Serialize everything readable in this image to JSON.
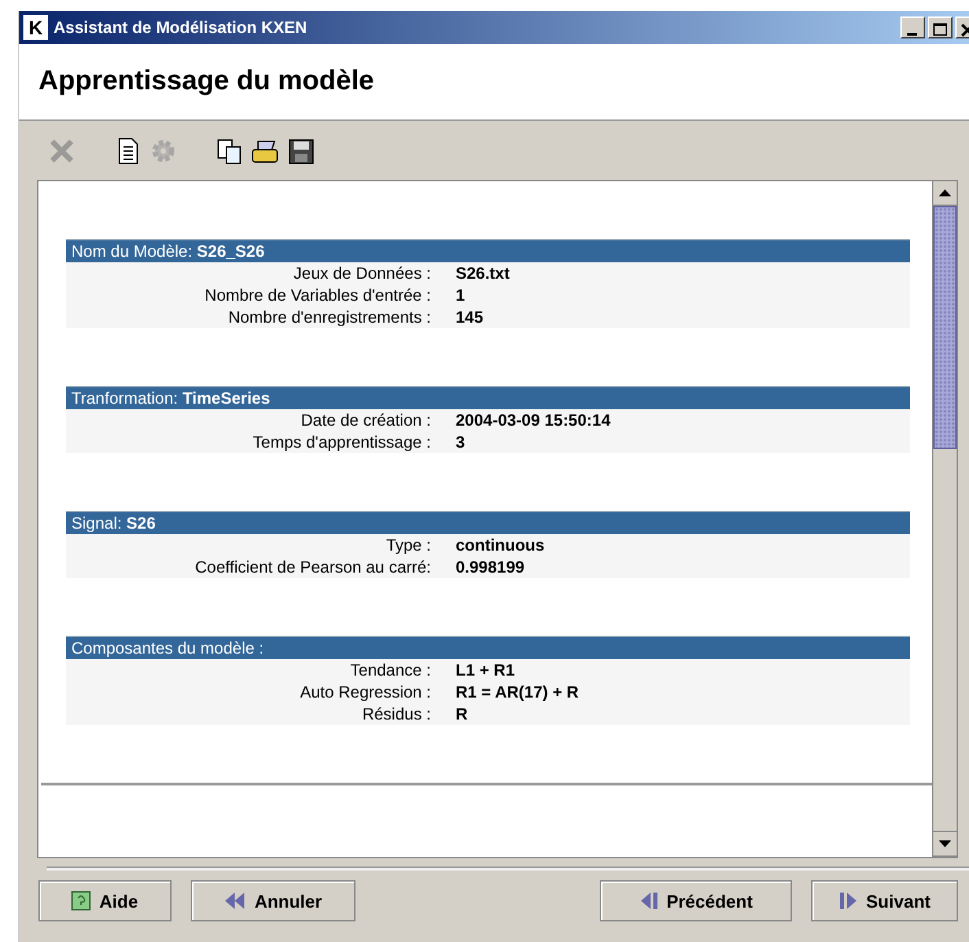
{
  "window": {
    "title": "Assistant de Modélisation KXEN",
    "logo": "K"
  },
  "header": {
    "title": "Apprentissage du modèle"
  },
  "toolbar": [
    {
      "kind": "delete",
      "disabled": true
    },
    {
      "kind": "document",
      "disabled": false
    },
    {
      "kind": "gear",
      "disabled": true
    },
    {
      "kind": "copy",
      "disabled": false
    },
    {
      "kind": "print",
      "disabled": false
    },
    {
      "kind": "save",
      "disabled": false
    }
  ],
  "sections": [
    {
      "label": "Nom du Modèle:",
      "value": "S26_S26",
      "rows": [
        {
          "label": "Jeux de Données :",
          "value": "S26.txt"
        },
        {
          "label": "Nombre de Variables d'entrée :",
          "value": "1"
        },
        {
          "label": "Nombre d'enregistrements :",
          "value": "145"
        }
      ]
    },
    {
      "label": "Tranformation:",
      "value": "TimeSeries",
      "rows": [
        {
          "label": "Date de création :",
          "value": "2004-03-09 15:50:14"
        },
        {
          "label": "Temps d'apprentissage :",
          "value": "3"
        }
      ]
    },
    {
      "label": "Signal:",
      "value": "S26",
      "rows": [
        {
          "label": "Type :",
          "value": "continuous"
        },
        {
          "label": "Coefficient de Pearson au carré:",
          "value": "0.998199"
        }
      ]
    },
    {
      "label": "Composantes du modèle :",
      "rows": [
        {
          "label": "Tendance :",
          "value": "L1 + R1"
        },
        {
          "label": "Auto Regression :",
          "value": "R1 = AR(17) + R"
        },
        {
          "label": "Résidus :",
          "value": "R"
        }
      ]
    }
  ],
  "buttons": [
    {
      "label": "Aide",
      "kind": "help"
    },
    {
      "label": "Annuler",
      "kind": "cancel"
    },
    {
      "label": "Précédent",
      "kind": "previous"
    },
    {
      "label": "Suivant",
      "kind": "next"
    }
  ]
}
